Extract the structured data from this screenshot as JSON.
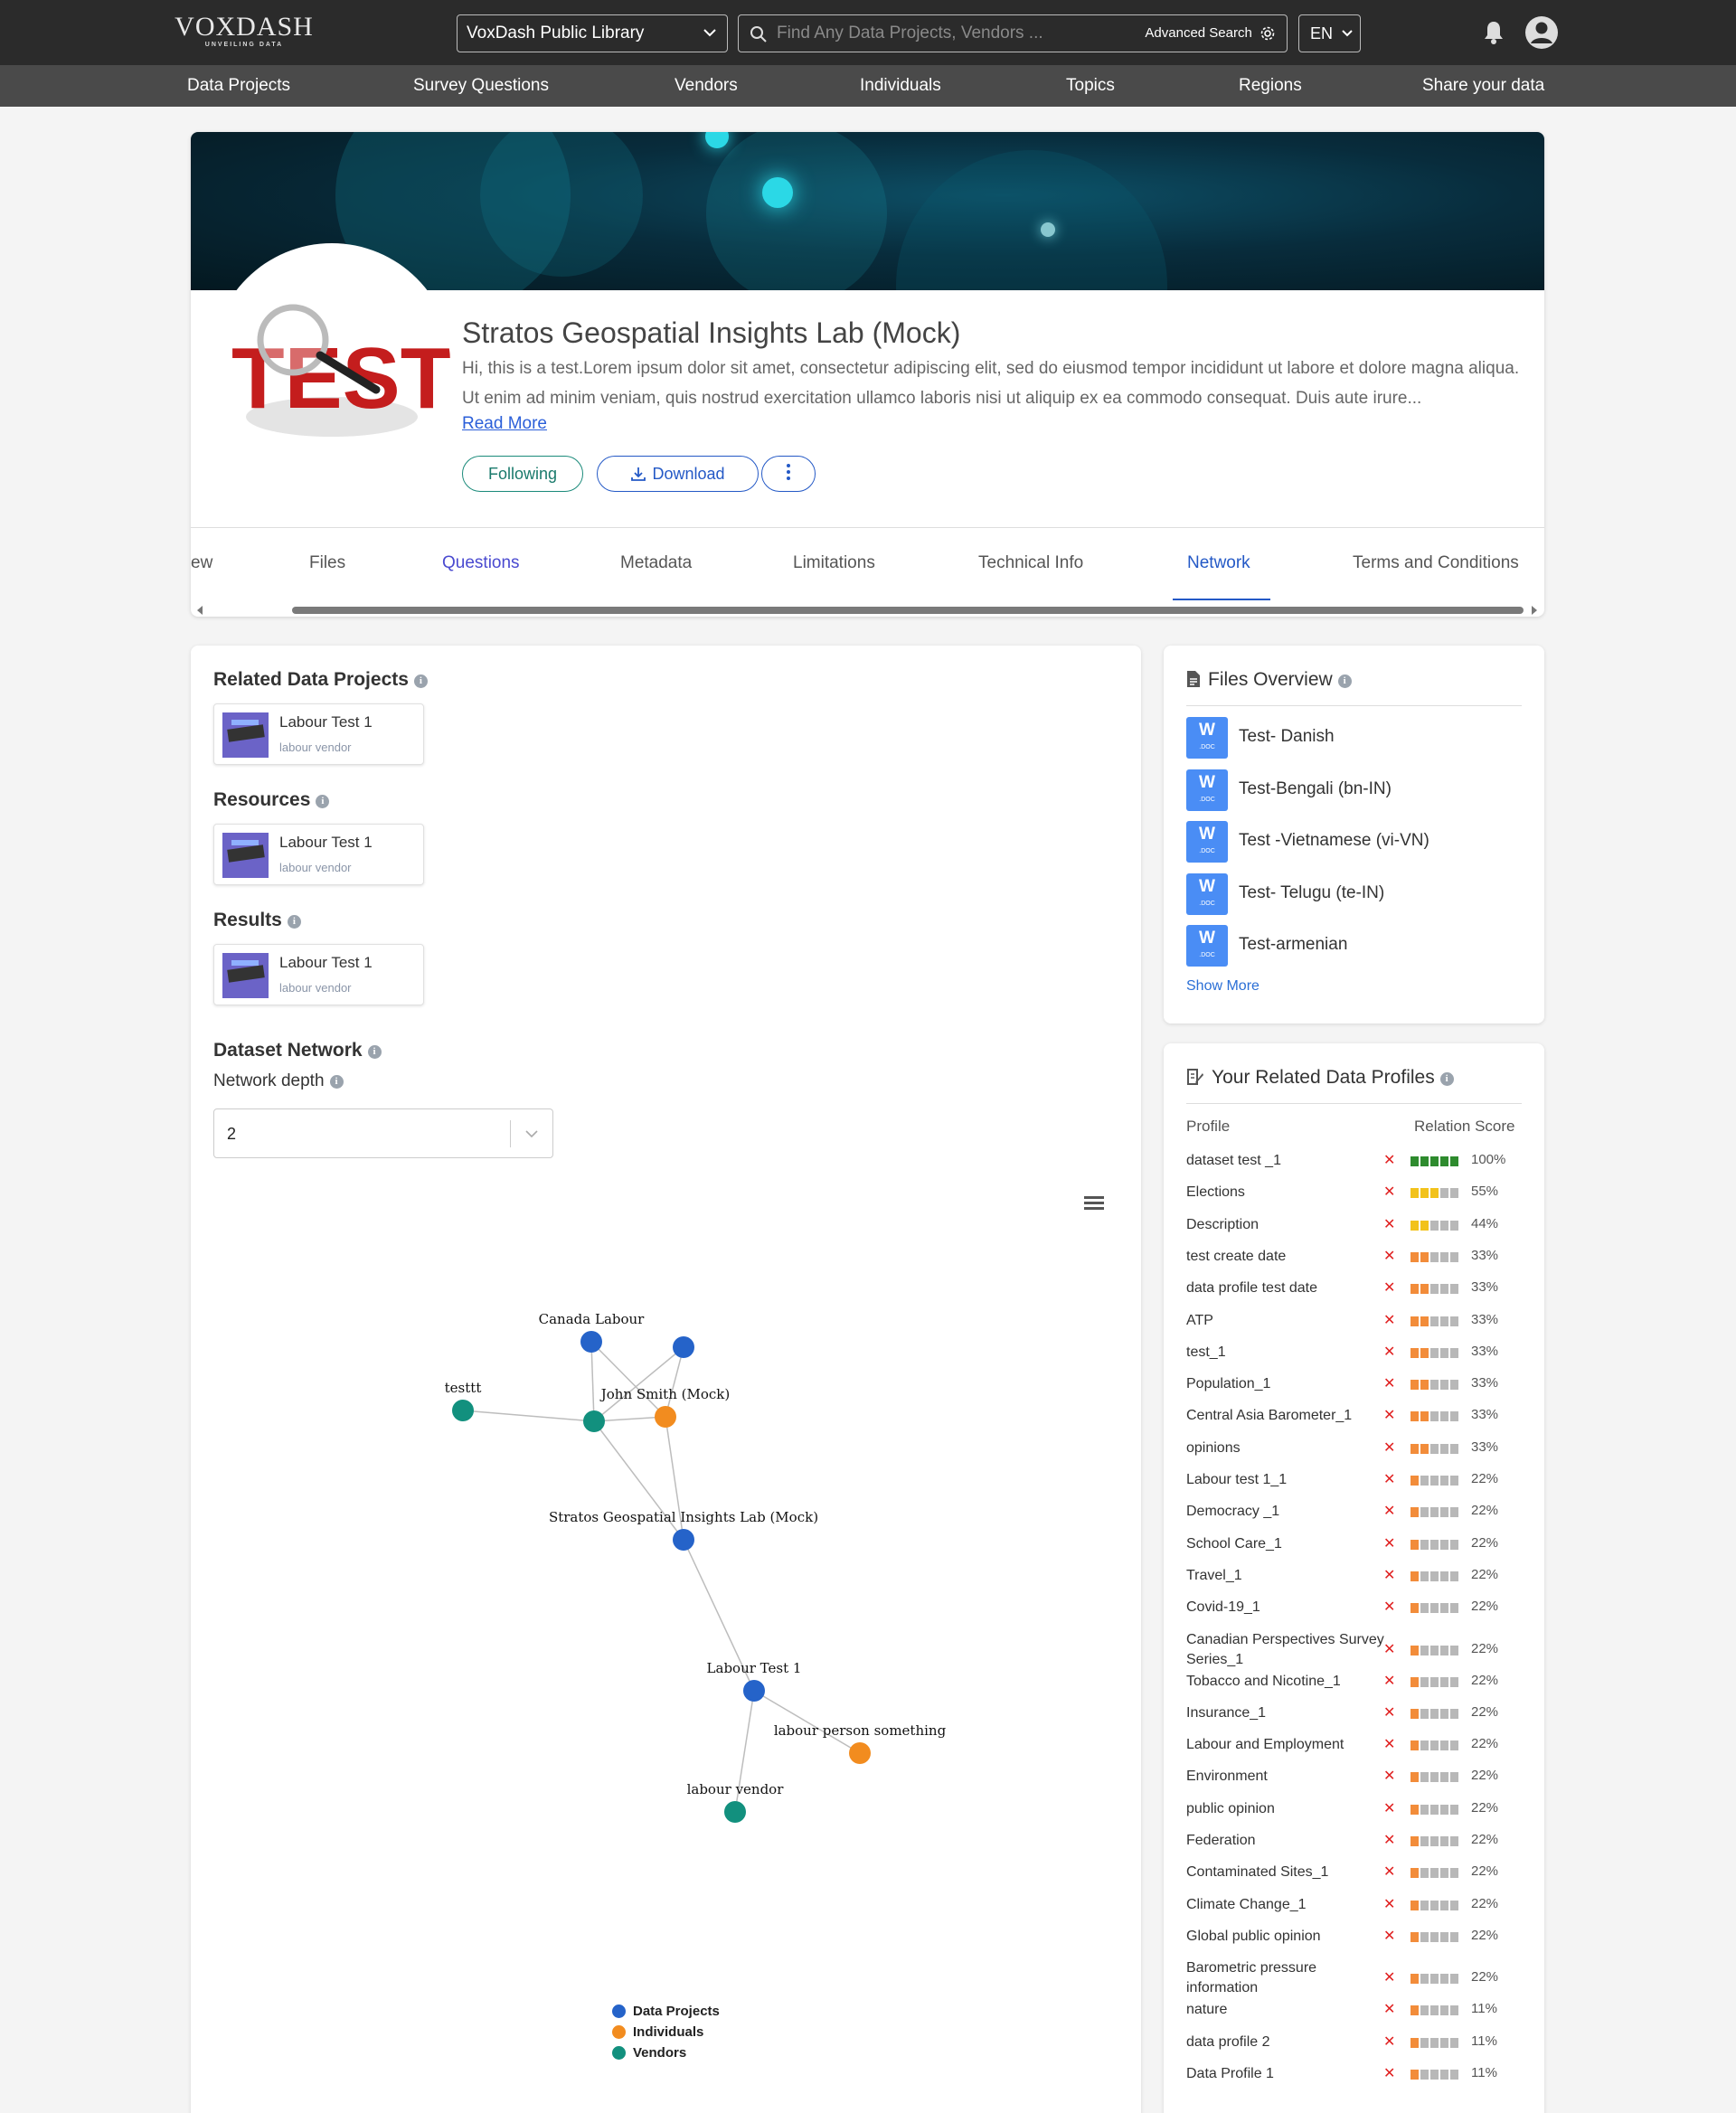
{
  "header": {
    "brand": "VOXDASH",
    "tagline": "UNVEILING DATA",
    "library": "VoxDash Public Library",
    "search_placeholder": "Find Any Data Projects, Vendors ...",
    "advanced_search": "Advanced Search",
    "language": "EN"
  },
  "nav": [
    "Data Projects",
    "Survey Questions",
    "Vendors",
    "Individuals",
    "Topics",
    "Regions",
    "Share your data"
  ],
  "profile": {
    "title": "Stratos Geospatial Insights Lab (Mock)",
    "description": "Hi, this is a test.Lorem ipsum dolor sit amet, consectetur adipiscing elit, sed do eiusmod tempor incididunt ut labore et dolore magna aliqua. Ut enim ad minim veniam, quis nostrud exercitation ullamco laboris nisi ut aliquip ex ea commodo consequat. Duis aute irure...",
    "read_more": "Read More",
    "following": "Following",
    "download": "Download",
    "logo_text": "TEST"
  },
  "tabs": [
    "ew",
    "Files",
    "Questions",
    "Metadata",
    "Limitations",
    "Technical Info",
    "Network",
    "Terms and Conditions"
  ],
  "active_tab": "Network",
  "related": {
    "projects_title": "Related Data Projects",
    "resources_title": "Resources",
    "results_title": "Results",
    "card_title": "Labour Test 1",
    "card_sub": "labour vendor"
  },
  "network": {
    "title": "Dataset Network",
    "depth_label": "Network depth",
    "depth_value": "2",
    "nodes": [
      {
        "label": "Canada Labour",
        "type": "project"
      },
      {
        "label": "",
        "type": "project"
      },
      {
        "label": "testtt",
        "type": "vendor"
      },
      {
        "label": "",
        "type": "vendor"
      },
      {
        "label": "John Smith (Mock)",
        "type": "individual"
      },
      {
        "label": "Stratos Geospatial Insights Lab (Mock)",
        "type": "project"
      },
      {
        "label": "Labour Test 1",
        "type": "project"
      },
      {
        "label": "labour person something",
        "type": "individual"
      },
      {
        "label": "labour vendor",
        "type": "vendor"
      }
    ],
    "legend": [
      "Data Projects",
      "Individuals",
      "Vendors"
    ],
    "colors": {
      "project": "#2563c9",
      "individual": "#f28c1f",
      "vendor": "#12907e"
    }
  },
  "files": {
    "title": "Files Overview",
    "items": [
      "Test- Danish",
      "Test-Bengali (bn-IN)",
      "Test -Vietnamese (vi-VN)",
      "Test- Telugu (te-IN)",
      "Test-armenian"
    ],
    "show_more": "Show More",
    "icon_letter": "W",
    "icon_ext": ".DOC"
  },
  "profiles": {
    "title": "Your Related Data Profiles",
    "col_profile": "Profile",
    "col_score": "Relation Score",
    "rows": [
      {
        "name": "dataset test _1",
        "score": "100%",
        "level": 5,
        "color": "#2e8b2e"
      },
      {
        "name": "Elections",
        "score": "55%",
        "level": 3,
        "color": "#f2c21b"
      },
      {
        "name": "Description",
        "score": "44%",
        "level": 2,
        "color": "#f2c21b"
      },
      {
        "name": "test create date",
        "score": "33%",
        "level": 2,
        "color": "#f28c3a"
      },
      {
        "name": "data profile test date",
        "score": "33%",
        "level": 2,
        "color": "#f28c3a"
      },
      {
        "name": "ATP",
        "score": "33%",
        "level": 2,
        "color": "#f28c3a"
      },
      {
        "name": "test_1",
        "score": "33%",
        "level": 2,
        "color": "#f28c3a"
      },
      {
        "name": "Population_1",
        "score": "33%",
        "level": 2,
        "color": "#f28c3a"
      },
      {
        "name": "Central Asia Barometer_1",
        "score": "33%",
        "level": 2,
        "color": "#f28c3a"
      },
      {
        "name": "opinions",
        "score": "33%",
        "level": 2,
        "color": "#f28c3a"
      },
      {
        "name": "Labour test 1_1",
        "score": "22%",
        "level": 1,
        "color": "#f28c3a"
      },
      {
        "name": "Democracy _1",
        "score": "22%",
        "level": 1,
        "color": "#f28c3a"
      },
      {
        "name": "School Care_1",
        "score": "22%",
        "level": 1,
        "color": "#f28c3a"
      },
      {
        "name": "Travel_1",
        "score": "22%",
        "level": 1,
        "color": "#f28c3a"
      },
      {
        "name": "Covid-19_1",
        "score": "22%",
        "level": 1,
        "color": "#f28c3a"
      },
      {
        "name": "Canadian Perspectives Survey Series_1",
        "score": "22%",
        "level": 1,
        "color": "#f28c3a"
      },
      {
        "name": "Tobacco and Nicotine_1",
        "score": "22%",
        "level": 1,
        "color": "#f28c3a"
      },
      {
        "name": "Insurance_1",
        "score": "22%",
        "level": 1,
        "color": "#f28c3a"
      },
      {
        "name": "Labour and Employment",
        "score": "22%",
        "level": 1,
        "color": "#f28c3a"
      },
      {
        "name": "Environment",
        "score": "22%",
        "level": 1,
        "color": "#f28c3a"
      },
      {
        "name": "public opinion",
        "score": "22%",
        "level": 1,
        "color": "#f28c3a"
      },
      {
        "name": "Federation",
        "score": "22%",
        "level": 1,
        "color": "#f28c3a"
      },
      {
        "name": "Contaminated Sites_1",
        "score": "22%",
        "level": 1,
        "color": "#f28c3a"
      },
      {
        "name": "Climate Change_1",
        "score": "22%",
        "level": 1,
        "color": "#f28c3a"
      },
      {
        "name": "Global public opinion",
        "score": "22%",
        "level": 1,
        "color": "#f28c3a"
      },
      {
        "name": "Barometric pressure information",
        "score": "22%",
        "level": 1,
        "color": "#f28c3a"
      },
      {
        "name": "nature",
        "score": "11%",
        "level": 1,
        "color": "#f28c3a"
      },
      {
        "name": "data profile 2",
        "score": "11%",
        "level": 1,
        "color": "#f28c3a"
      },
      {
        "name": "Data Profile 1",
        "score": "11%",
        "level": 1,
        "color": "#f28c3a"
      }
    ]
  }
}
